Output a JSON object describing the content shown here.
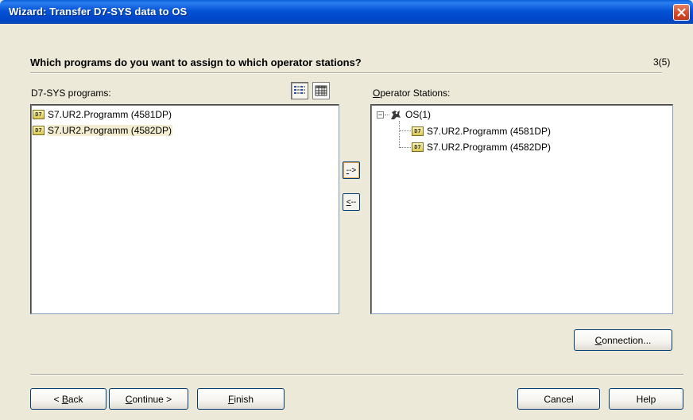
{
  "window": {
    "title": "Wizard: Transfer D7-SYS data to OS"
  },
  "header": {
    "question": "Which programs do you want to assign to which operator stations?",
    "step": "3(5)"
  },
  "left_panel": {
    "label_prefix": "D7-SYS programs:",
    "view_buttons": [
      {
        "icon": "list-view-icon",
        "pressed": true
      },
      {
        "icon": "details-view-icon",
        "pressed": false
      }
    ],
    "items": [
      {
        "icon_text": "D7",
        "label": "S7.UR2.Programm (4581DP)",
        "selected": false
      },
      {
        "icon_text": "D7",
        "label": "S7.UR2.Programm (4582DP)",
        "selected": true
      }
    ]
  },
  "right_panel": {
    "label_mnemonic": "O",
    "label_rest": "perator Stations:",
    "tree": {
      "expander": "−",
      "root_label": "OS(1)",
      "children": [
        {
          "icon_text": "D7",
          "label": "S7.UR2.Programm (4581DP)"
        },
        {
          "icon_text": "D7",
          "label": "S7.UR2.Programm (4582DP)"
        }
      ]
    }
  },
  "transfer": {
    "assign_mnemonic": "-",
    "assign_rest": "->",
    "remove_mnemonic": "<",
    "remove_rest": "--"
  },
  "buttons": {
    "connection_mnemonic": "C",
    "connection_rest": "onnection...",
    "back_prefix": "< ",
    "back_mnemonic": "B",
    "back_rest": "ack",
    "continue_mnemonic": "C",
    "continue_rest": "ontinue >",
    "finish_mnemonic": "F",
    "finish_rest": "inish",
    "cancel": "Cancel",
    "help": "Help"
  },
  "colors": {
    "titlebar": "#0553d6",
    "dialog_bg": "#ece9d8",
    "selected_item_bg": "#f3eed1",
    "close_button": "#d7502e"
  }
}
